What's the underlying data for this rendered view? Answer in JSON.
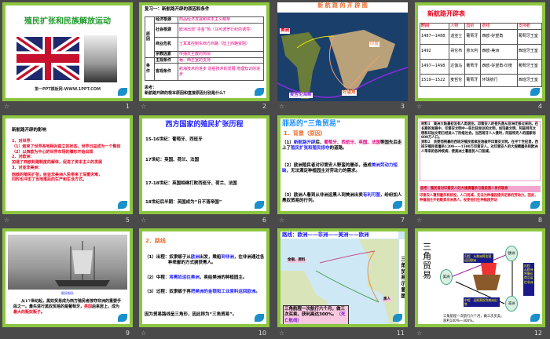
{
  "slides": [
    {
      "num": "1",
      "title": "殖民扩张和民族解放运动",
      "footer": "第一PPT模板网-WWW.1PPT.COM"
    },
    {
      "num": "2",
      "title": "复习一：新航路开辟的原因和条件",
      "g1": "原因",
      "g2": "条件",
      "rows": [
        [
          "经济根源",
          "商品经济发展和资本主义萌芽"
        ],
        [
          "社会根源",
          "欧洲出现“寻金”热（马可波罗行纪的诱导）"
        ],
        [
          "商业危机",
          "土耳其控制东西方商路（陆上商路受阻）"
        ],
        [
          "宗教因素",
          "传播天主教的热情"
        ],
        [
          "主观条件",
          "葡、西王室的支持"
        ],
        [
          "客观条件",
          "航海技术的进步 造船技术的发展 地理知识的进步"
        ]
      ],
      "think_label": "思考：",
      "think": "新航路开辟的根本原因和直接原因分别是什么？"
    },
    {
      "num": "3",
      "title": "新 航 路 的 开 辟 图",
      "labels": [
        "美洲",
        "印度",
        "麦哲伦海峡",
        "好望角"
      ]
    },
    {
      "num": "4",
      "title": "新航路开辟表",
      "headers": [
        "时间",
        "人物",
        "国别",
        "航线",
        "支持者"
      ],
      "rows": [
        [
          "1487—1488",
          "迪亚士",
          "葡萄牙",
          "西欧-好望角",
          "葡萄牙王室"
        ],
        [
          "1492",
          "哥伦布",
          "意大利",
          "西欧-美洲",
          "西班牙王室"
        ],
        [
          "1497—1498",
          "达伽马",
          "葡萄牙",
          "西欧-好望角-印度",
          "葡萄牙王室"
        ],
        [
          "1519—1522",
          "麦哲伦",
          "葡萄牙",
          "环球航行",
          "西班牙王室"
        ]
      ]
    },
    {
      "num": "5",
      "title": "新航路开辟的影响",
      "lines": [
        "1、对世界：",
        "（1）结束了世界各地相对孤立的状态，世界日益成为一个整体",
        "（2）以西欧为中心的世界市场的雏形开始出现",
        "2、对欧洲：",
        "加速了西欧封建制度的解体，促进了资本主义的发展",
        "3、对亚非美洲：",
        "西欧的殖民扩张，给亚非美洲人民带来了深重灾难，同时也冲击了当地落后的生产和生活方式。"
      ]
    },
    {
      "num": "6",
      "title": "西方国家的殖民扩张历程",
      "lines": [
        "15-16世纪：葡萄牙、西班牙",
        "17世纪：英国、荷兰、法国",
        "17-18世纪：英国相继打败西班牙、荷兰、法国",
        "18世纪后半期：英国成为“日不落帝国”"
      ]
    },
    {
      "num": "7",
      "title": "罪恶的“三角贸易”",
      "sub": "1．背景（原因）",
      "p1a": "（1）",
      "p1b": "新航路开辟",
      "p1c": "后，",
      "p1d": "葡萄牙、西班牙、英国、法国",
      "p1e": "等国先后走上了",
      "p1f": "殖民扩张和殖民掠夺",
      "p1g": "的道路。",
      "p2a": "（2）欧洲殖民者对印第安人野蛮的屠杀，造成",
      "p2b": "美洲劳动力短缺",
      "p2c": "，无法满足种植园主对劳动力的需求。",
      "p3a": "（3）欧洲人看到从非洲运黑人到美洲出卖",
      "p3b": "有利可图",
      "p3c": "，纷纷加人黑奴贸易的行列。"
    },
    {
      "num": "8",
      "m1": "材料1　美洲大陆最初没有人类居住。印第安人的祖先是从亚洲迁移过来的。在长期的发展中，印第安文明中一些比较发达的文明，如玛雅文明、阿兹特克文明和印加文明已经进入了阶级社会。当西班牙人入侵时，阿兹特克人的国家有600万人口。",
      "m2": "资料2　贪婪而残暴的西班牙殖民者疯狂地破坏印第安文明。在半个世纪里，西班牙殖民者屠杀1200——1500万印第安人。对印第安人的大规模屠杀和欧洲人带来的各种疾病，使美洲土著居民人口锐减。",
      "think": "思考：殖民者对印第安人的大规模屠杀与贩卖黑人有何联系",
      "answer": "印第安人遭到屠杀和奴役，人口锐减，无法为种植园提供足够的劳动力。因此，种植园主开始贩卖非洲黑人，役使他们在种植园劳动"
    },
    {
      "num": "9",
      "caption": "贩奴船队",
      "t1": "从17世纪起，黑奴贸易成为西方殖民者掠夺非洲的重要手段之一。最先进行黑奴贸易的是葡萄牙，",
      "t2": "英国",
      "t3": "后来居上，成为",
      "t4": "最大的贩奴贩子",
      "t5": "。"
    },
    {
      "num": "10",
      "title": "2．路线",
      "r1a": "（1）出程：奴隶贩子从",
      "r1b": "欧洲",
      "r1c": "出发，乘船",
      "r1d": "到非洲",
      "r1e": "，在非洲通过各种卑鄙的方式掳获黑人。",
      "r2a": "（2）中程：",
      "r2b": "将黑奴运往美洲",
      "r2c": "，卖给美洲的种植园主。",
      "r3a": "（3）过程：奴隶贩子再",
      "r3b": "把美洲的金银和工业原料运回欧洲",
      "r3c": "。",
      "concl": "因为贸易路线呈三角形，因此称为“三角贸易”。"
    },
    {
      "num": "11",
      "title": "路线：欧洲——非洲——美洲——欧洲",
      "side": "三角贸易示意图",
      "tag1": "金银、原料",
      "tag2": "黑人",
      "box1": "三角航程一次航行六个月，做三次买卖，获利高达300%。",
      "box2": "（死亡航线）"
    },
    {
      "num": "12",
      "title": "三角贸易",
      "nodes": [
        "欧洲",
        "美洲",
        "非洲"
      ],
      "l1": "归程　从美洲将金银运回欧洲",
      "l2": "出程　从欧洲将廉价商品运往非洲",
      "l3": "中程　运贩黑奴到美洲出售",
      "note": "三角航程一次航行六个月，做三次买卖，获利100%—300%。"
    }
  ],
  "colors": {
    "border": "#8cc63f",
    "bg": "#4a4a4a",
    "red": "#e8001c",
    "blue": "#1a1aff"
  }
}
